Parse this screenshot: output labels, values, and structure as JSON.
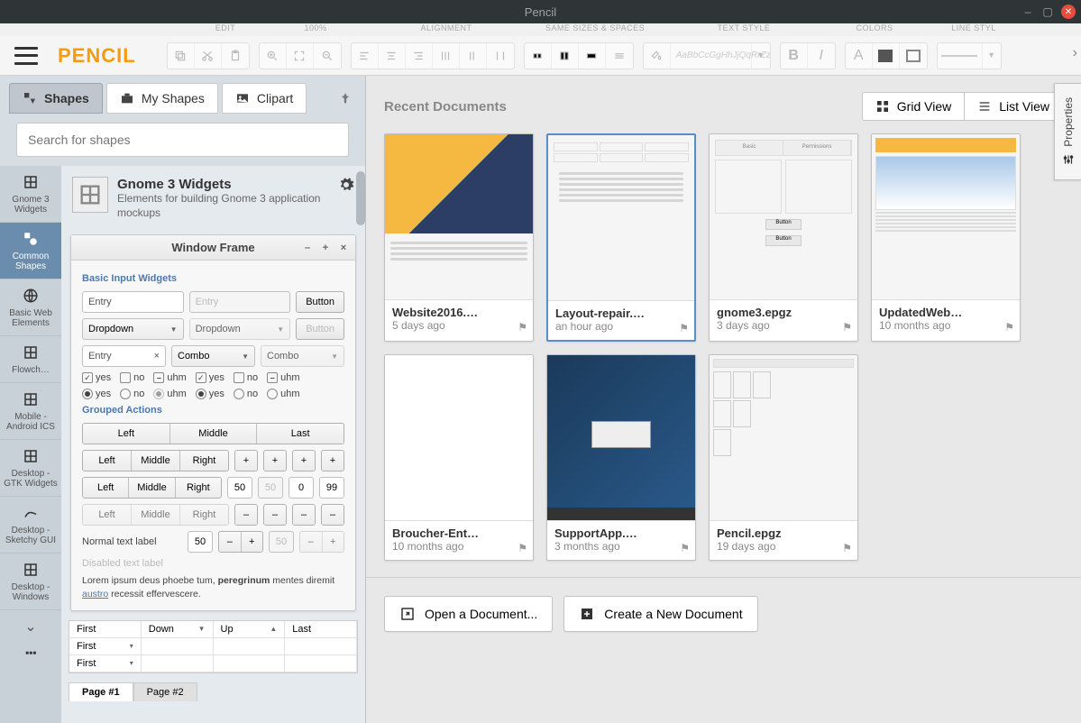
{
  "titlebar": {
    "title": "Pencil"
  },
  "app": {
    "logo": "PENCIL"
  },
  "menubar": {
    "edit": "EDIT",
    "zoom": "100%",
    "alignment": "ALIGNMENT",
    "sizes": "SAME SIZES & SPACES",
    "textstyle": "TEXT STYLE",
    "colors": "COLORS",
    "linestyle": "LINE STYL"
  },
  "toolbar": {
    "font_placeholder": "AaBbCcGgHhJjQqRrZz"
  },
  "left": {
    "tabs": {
      "shapes": "Shapes",
      "myshapes": "My Shapes",
      "clipart": "Clipart"
    },
    "search_placeholder": "Search for shapes",
    "categories": [
      {
        "label": "Gnome 3 Widgets"
      },
      {
        "label": "Common Shapes"
      },
      {
        "label": "Basic Web Elements"
      },
      {
        "label": "Flowch…"
      },
      {
        "label": "Mobile - Android ICS"
      },
      {
        "label": "Desktop - GTK Widgets"
      },
      {
        "label": "Desktop - Sketchy GUI"
      },
      {
        "label": "Desktop - Windows"
      }
    ],
    "collection": {
      "title": "Gnome 3 Widgets",
      "desc": "Elements for building Gnome 3 application mockups"
    },
    "mockup": {
      "window_title": "Window Frame",
      "basic_section": "Basic Input Widgets",
      "entry": "Entry",
      "button": "Button",
      "dropdown": "Dropdown",
      "combo": "Combo",
      "yes": "yes",
      "no": "no",
      "uhm": "uhm",
      "grouped_section": "Grouped Actions",
      "left": "Left",
      "middle": "Middle",
      "right": "Right",
      "last": "Last",
      "n50": "50",
      "n0": "0",
      "n99": "99",
      "normal_label": "Normal text label",
      "disabled_label": "Disabled text label",
      "lorem_a": "Lorem ipsum deus phoebe tum, ",
      "lorem_b": "peregrinum",
      "lorem_c": " mentes diremit ",
      "lorem_link": "austro",
      "lorem_d": " recessit effervescere.",
      "table": {
        "first": "First",
        "down": "Down",
        "up": "Up",
        "last": "Last"
      },
      "pages": {
        "p1": "Page #1",
        "p2": "Page #2"
      }
    }
  },
  "right": {
    "title": "Recent Documents",
    "views": {
      "grid": "Grid View",
      "list": "List View"
    },
    "docs": [
      {
        "name": "Website2016.…",
        "time": "5 days ago"
      },
      {
        "name": "Layout-repair.…",
        "time": "an hour ago"
      },
      {
        "name": "gnome3.epgz",
        "time": "3 days ago"
      },
      {
        "name": "UpdatedWeb…",
        "time": "10 months ago"
      },
      {
        "name": "Broucher-Ent…",
        "time": "10 months ago"
      },
      {
        "name": "SupportApp.…",
        "time": "3 months ago"
      },
      {
        "name": "Pencil.epgz",
        "time": "19 days ago"
      }
    ],
    "actions": {
      "open": "Open a Document...",
      "create": "Create a New Document"
    }
  },
  "props_tab": "Properties"
}
